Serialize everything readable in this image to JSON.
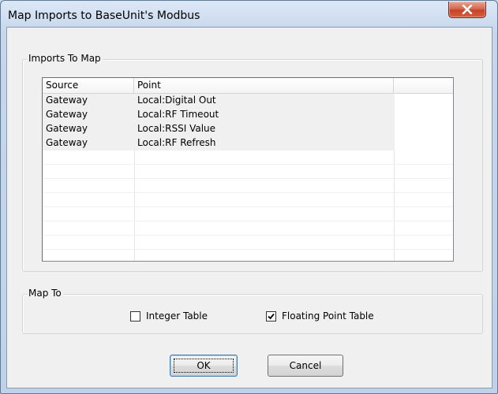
{
  "window": {
    "title": "Map Imports to BaseUnit's Modbus"
  },
  "imports_group": {
    "label": "Imports To Map",
    "columns": [
      "Source",
      "Point",
      ""
    ],
    "rows": [
      {
        "source": "Gateway",
        "point": "Local:Digital Out"
      },
      {
        "source": "Gateway",
        "point": "Local:RF Timeout"
      },
      {
        "source": "Gateway",
        "point": "Local:RSSI Value"
      },
      {
        "source": "Gateway",
        "point": "Local:RF Refresh"
      }
    ]
  },
  "map_to_group": {
    "label": "Map To",
    "integer_table": {
      "label": "Integer Table",
      "checked": false
    },
    "floating_point_table": {
      "label": "Floating Point Table",
      "checked": true
    }
  },
  "buttons": {
    "ok": "OK",
    "cancel": "Cancel"
  },
  "icons": {
    "close": "close-icon",
    "check": "checkmark-icon"
  },
  "colors": {
    "title_bar": "#c9d9ec",
    "close_button": "#c7432a",
    "dialog_background": "#f0f0f0"
  }
}
